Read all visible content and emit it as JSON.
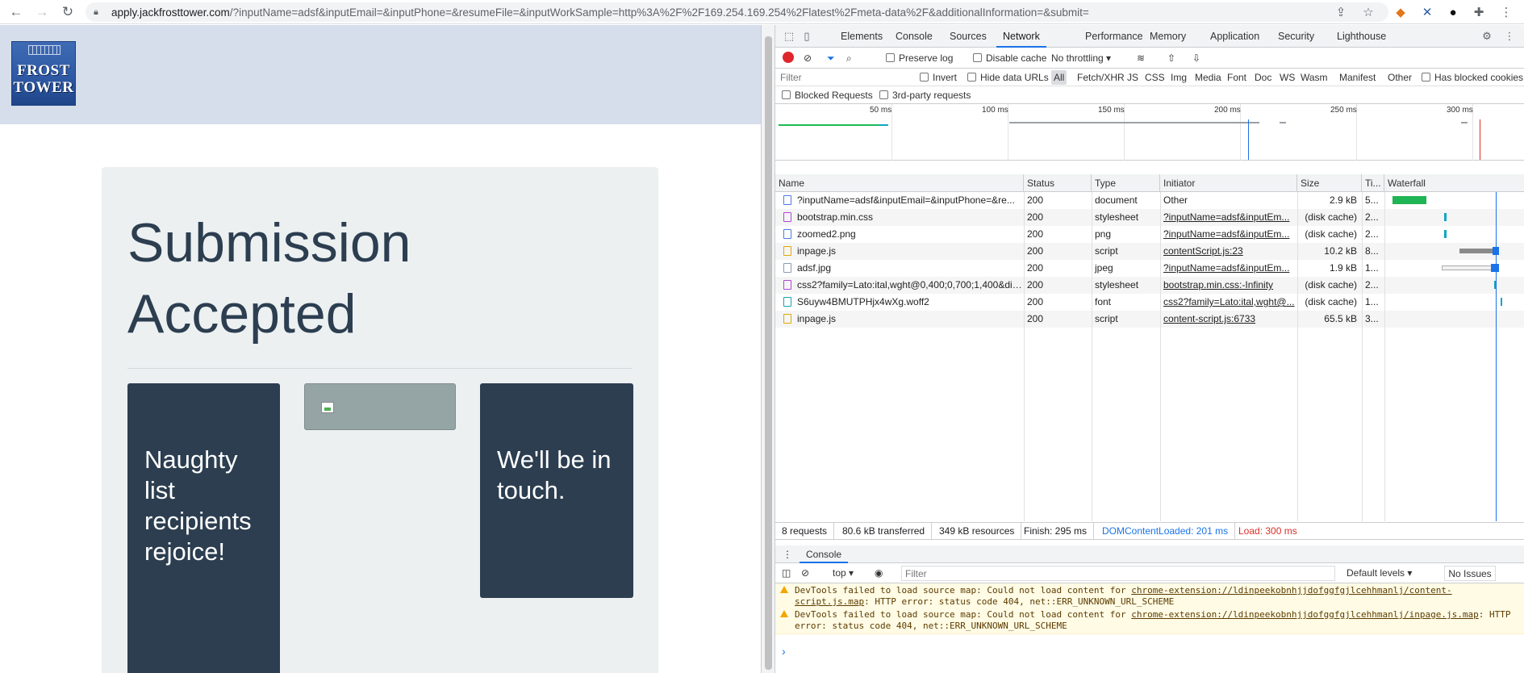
{
  "browser": {
    "url_host": "apply.jackfrosttower.com",
    "url_path": "/?inputName=adsf&inputEmail=&inputPhone=&resumeFile=&inputWorkSample=http%3A%2F%2F169.254.169.254%2Flatest%2Fmeta-data%2F&additionalInformation=&submit="
  },
  "site": {
    "logo_line1": "FROST",
    "logo_line2": "TOWER",
    "title_line1": "Submission",
    "title_line2": "Accepted",
    "tile_left": "Naughty list recipients rejoice!",
    "tile_right": "We'll be in touch."
  },
  "devtools": {
    "tabs": [
      "Elements",
      "Console",
      "Sources",
      "Network",
      "Performance",
      "Memory",
      "Application",
      "Security",
      "Lighthouse"
    ],
    "active_tab": "Network",
    "toolbar": {
      "preserve_log": "Preserve log",
      "disable_cache": "Disable cache",
      "throttling": "No throttling"
    },
    "filter_placeholder": "Filter",
    "filter_options": [
      "Invert",
      "Hide data URLs"
    ],
    "type_filters": [
      "All",
      "Fetch/XHR",
      "JS",
      "CSS",
      "Img",
      "Media",
      "Font",
      "Doc",
      "WS",
      "Wasm",
      "Manifest",
      "Other"
    ],
    "has_blocked_cookies": "Has blocked cookies",
    "blocked_requests": "Blocked Requests",
    "third_party": "3rd-party requests",
    "timeline_ticks": [
      "50 ms",
      "100 ms",
      "150 ms",
      "200 ms",
      "250 ms",
      "300 ms"
    ],
    "columns": [
      "Name",
      "Status",
      "Type",
      "Initiator",
      "Size",
      "Ti...",
      "Waterfall"
    ],
    "rows": [
      {
        "name": "?inputName=adsf&inputEmail=&inputPhone=&re...",
        "status": "200",
        "type": "document",
        "initiator": "Other",
        "size": "2.9 kB",
        "time": "5...",
        "icon_color": "#4a7be0"
      },
      {
        "name": "bootstrap.min.css",
        "status": "200",
        "type": "stylesheet",
        "initiator": "?inputName=adsf&inputEm...",
        "size": "(disk cache)",
        "time": "2...",
        "icon_color": "#b146d6"
      },
      {
        "name": "zoomed2.png",
        "status": "200",
        "type": "png",
        "initiator": "?inputName=adsf&inputEm...",
        "size": "(disk cache)",
        "time": "2...",
        "icon_color": "#4a7be0"
      },
      {
        "name": "inpage.js",
        "status": "200",
        "type": "script",
        "initiator": "contentScript.js:23",
        "size": "10.2 kB",
        "time": "8...",
        "icon_color": "#e0a800"
      },
      {
        "name": "adsf.jpg",
        "status": "200",
        "type": "jpeg",
        "initiator": "?inputName=adsf&inputEm...",
        "size": "1.9 kB",
        "time": "1...",
        "icon_color": "#8a9bb8"
      },
      {
        "name": "css2?family=Lato:ital,wght@0,400;0,700;1,400&dis...",
        "status": "200",
        "type": "stylesheet",
        "initiator": "bootstrap.min.css:-Infinity",
        "size": "(disk cache)",
        "time": "2...",
        "icon_color": "#b146d6"
      },
      {
        "name": "S6uyw4BMUTPHjx4wXg.woff2",
        "status": "200",
        "type": "font",
        "initiator": "css2?family=Lato:ital,wght@...",
        "size": "(disk cache)",
        "time": "1...",
        "icon_color": "#1aa0b8"
      },
      {
        "name": "inpage.js",
        "status": "200",
        "type": "script",
        "initiator": "content-script.js:6733",
        "size": "65.5 kB",
        "time": "3...",
        "icon_color": "#e0a800"
      }
    ],
    "summary": {
      "requests": "8 requests",
      "transferred": "80.6 kB transferred",
      "resources": "349 kB resources",
      "finish": "Finish: 295 ms",
      "domcontentloaded": "DOMContentLoaded: 201 ms",
      "load": "Load: 300 ms"
    },
    "drawer_tab": "Console",
    "console": {
      "context": "top",
      "filter_placeholder": "Filter",
      "levels": "Default levels",
      "issues": "No Issues",
      "warnings": [
        {
          "text": "DevTools failed to load source map: Could not load content for ",
          "link": "chrome-extension://ldinpeekobnhjjdofggfgjlcehhmanlj/content-script.js.map",
          "tail": ": HTTP error: status code 404, net::ERR_UNKNOWN_URL_SCHEME"
        },
        {
          "text": "DevTools failed to load source map: Could not load content for ",
          "link": "chrome-extension://ldinpeekobnhjjdofggfgjlcehhmanlj/inpage.js.map",
          "tail": ": HTTP error: status code 404, net::ERR_UNKNOWN_URL_SCHEME"
        }
      ],
      "prompt": "›"
    }
  }
}
